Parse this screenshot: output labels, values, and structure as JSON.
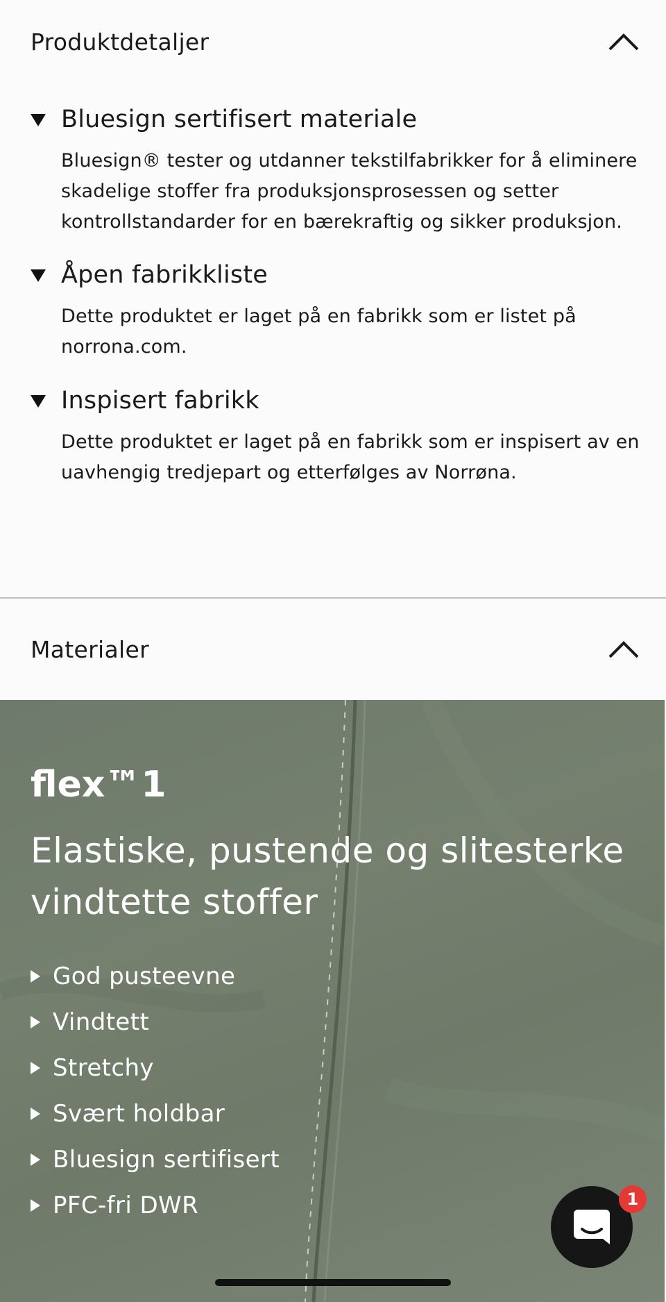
{
  "product_details": {
    "title": "Produktdetaljer",
    "toggle_icon": "chevron-up-icon",
    "items": [
      {
        "title": "Bluesign sertifisert materiale",
        "body": "Bluesign® tester og utdanner tekstilfabrikker for å eliminere skadelige stoffer fra produksjonsprosessen og setter kontrollstandarder for en bærekraftig og sikker produksjon."
      },
      {
        "title": "Åpen fabrikkliste",
        "body": "Dette produktet er laget på en fabrikk som er listet på norrona.com."
      },
      {
        "title": "Inspisert fabrikk",
        "body": "Dette produktet er laget på en fabrikk som er inspisert av en uavhengig tredjepart og etterfølges av Norrøna."
      }
    ]
  },
  "materials": {
    "title": "Materialer",
    "toggle_icon": "chevron-up-icon",
    "material_name": "flex™1",
    "material_description": "Elastiske, pustende og slitesterke vindtette stoffer",
    "features": [
      "God pusteevne",
      "Vindtett",
      "Stretchy",
      "Svært holdbar",
      "Bluesign sertifisert",
      "PFC-fri DWR"
    ]
  },
  "chat": {
    "icon": "chat-bubble-icon",
    "badge_count": "1"
  },
  "colors": {
    "background": "#fbfbfb",
    "text": "#1a1a1a",
    "material_panel": "#727d6d",
    "badge": "#e53935",
    "chat_button": "#161616"
  }
}
